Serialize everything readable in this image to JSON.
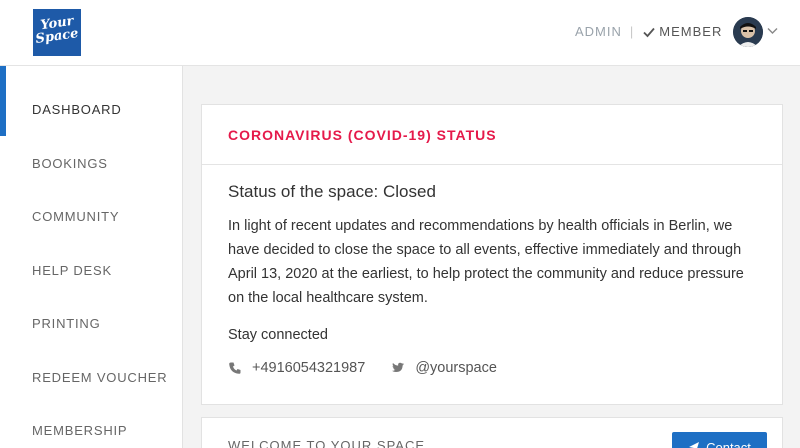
{
  "brand": {
    "logo_line1": "Your",
    "logo_line2": "Space"
  },
  "header": {
    "role_admin": "ADMIN",
    "role_separator": "|",
    "role_member": "MEMBER"
  },
  "sidebar": {
    "items": [
      {
        "label": "DASHBOARD"
      },
      {
        "label": "BOOKINGS"
      },
      {
        "label": "COMMUNITY"
      },
      {
        "label": "HELP DESK"
      },
      {
        "label": "PRINTING"
      },
      {
        "label": "REDEEM VOUCHER"
      },
      {
        "label": "MEMBERSHIP"
      }
    ]
  },
  "status_card": {
    "title": "CORONAVIRUS (COVID-19) STATUS",
    "status_line": "Status of the space: Closed",
    "paragraph": "In light of recent updates and recommendations by health officials in Berlin, we have decided to close the space to all events, effective immediately and through April 13, 2020 at the earliest, to help protect the community and reduce pressure on the local healthcare system.",
    "stay_connected": "Stay connected",
    "phone": "+4916054321987",
    "twitter": "@yourspace"
  },
  "welcome_card": {
    "title": "WELCOME TO YOUR SPACE",
    "contact_button": "Contact"
  },
  "colors": {
    "accent": "#1e6fc4",
    "alert": "#e5194a",
    "logo": "#1e5aa8"
  },
  "icons": [
    "check-icon",
    "chevron-down-icon",
    "phone-icon",
    "twitter-icon",
    "send-icon"
  ]
}
